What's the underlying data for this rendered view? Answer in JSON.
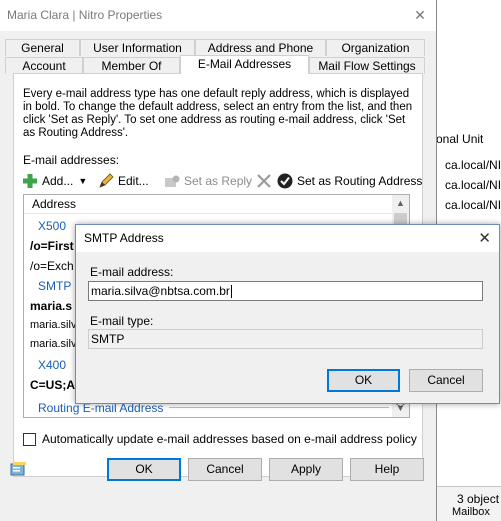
{
  "background_window": {
    "column_header": "onal Unit",
    "rows": [
      "ca.local/NITI",
      "ca.local/NITI",
      "ca.local/NITI"
    ],
    "status_count": "3 object",
    "status_sub": "Mailbox"
  },
  "dialog": {
    "title": "Maria Clara | Nitro Properties",
    "close_glyph": "✕",
    "tabs_row_back": [
      "General",
      "User Information",
      "Address and Phone",
      "Organization"
    ],
    "tabs_row_front": [
      "Account",
      "Member Of",
      "E-Mail Addresses",
      "Mail Flow Settings"
    ],
    "active_tab": "E-Mail Addresses",
    "description": "Every e-mail address type has one default reply address, which is displayed in bold. To change the default address, select an entry from the list, and then click 'Set as Reply'. To set one address as routing e-mail address, click 'Set as Routing Address'.",
    "email_addresses_label": "E-mail addresses:",
    "toolbar": {
      "add_label": "Add...",
      "edit_label": "Edit...",
      "set_reply_label": "Set as Reply",
      "set_routing_label": "Set as Routing Address"
    },
    "list": {
      "header": "Address",
      "items": [
        {
          "text": "X500",
          "kind": "group"
        },
        {
          "text": "/o=First",
          "kind": "bold"
        },
        {
          "text": "/o=Exch",
          "kind": "normal"
        },
        {
          "text": "SMTP",
          "kind": "group"
        },
        {
          "text": "maria.s",
          "kind": "bold"
        },
        {
          "text": "maria.silv",
          "kind": "small"
        },
        {
          "text": "maria.silv",
          "kind": "small"
        },
        {
          "text": "X400",
          "kind": "group"
        },
        {
          "text": "C=US;A",
          "kind": "bold"
        },
        {
          "text": "Routing E-mail Address",
          "kind": "group"
        }
      ]
    },
    "auto_update_label": "Automatically update e-mail addresses based on e-mail address policy",
    "buttons": {
      "ok": "OK",
      "cancel": "Cancel",
      "apply": "Apply",
      "help": "Help"
    }
  },
  "smtp_modal": {
    "title": "SMTP Address",
    "close_glyph": "✕",
    "email_label": "E-mail address:",
    "email_value": "maria.silva@nbtsa.com.br",
    "type_label": "E-mail type:",
    "type_value": "SMTP",
    "ok_label": "OK",
    "cancel_label": "Cancel"
  },
  "colors": {
    "accent": "#0078d7",
    "group_text": "#1a5fb4",
    "dialog_bg": "#f0f0f0"
  },
  "icons": [
    "add-icon",
    "edit-icon",
    "set-reply-icon",
    "remove-icon",
    "routing-check-icon",
    "properties-icon"
  ]
}
